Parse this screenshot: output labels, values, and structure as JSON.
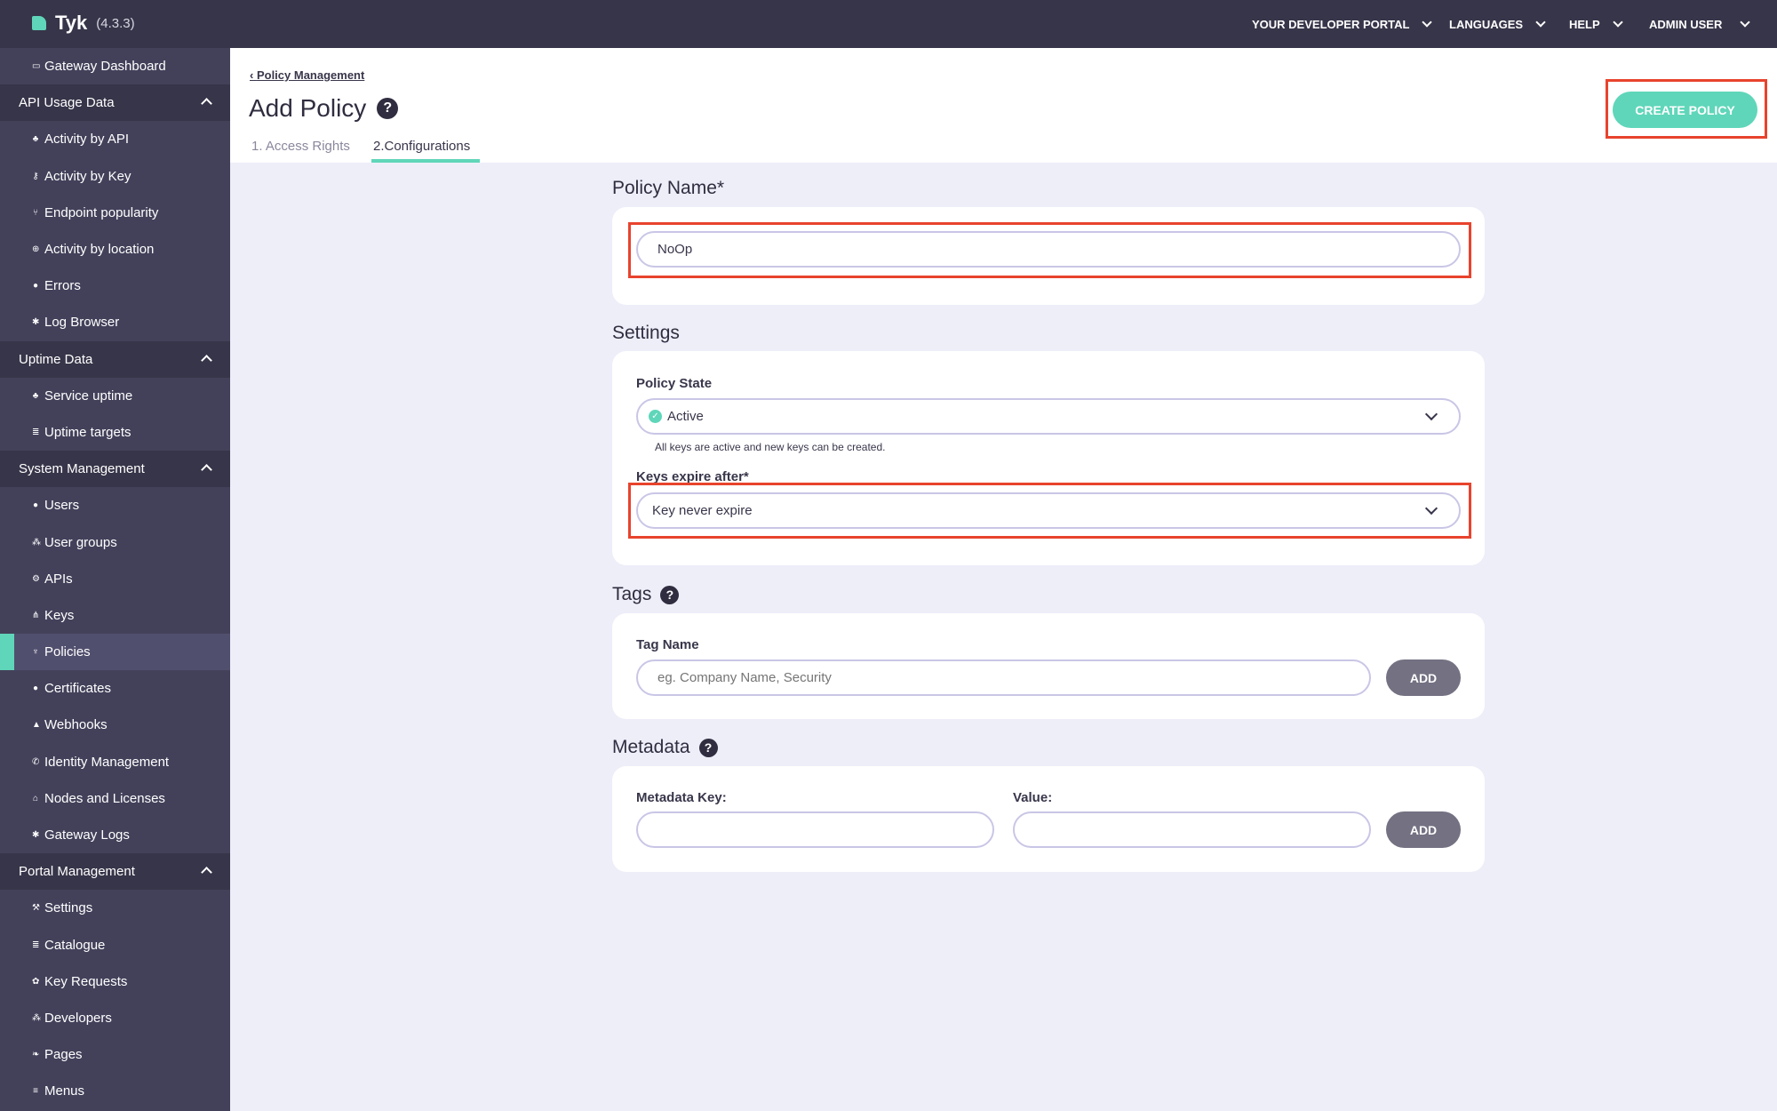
{
  "topbar": {
    "logo": "Tyk",
    "version": "(4.3.3)",
    "nav": [
      "YOUR DEVELOPER PORTAL",
      "LANGUAGES",
      "HELP",
      "ADMIN USER"
    ]
  },
  "sidebar": {
    "items": [
      {
        "label": "Gateway Dashboard",
        "type": "item",
        "icon": "monitor-icon",
        "glyph": "▭"
      },
      {
        "label": "API Usage Data",
        "type": "head"
      },
      {
        "label": "Activity by API",
        "type": "item",
        "icon": "cubes-icon",
        "glyph": "♣"
      },
      {
        "label": "Activity by Key",
        "type": "item",
        "icon": "key-icon",
        "glyph": "⚷"
      },
      {
        "label": "Endpoint popularity",
        "type": "item",
        "icon": "fork-icon",
        "glyph": "⑂"
      },
      {
        "label": "Activity by location",
        "type": "item",
        "icon": "globe-icon",
        "glyph": "⊕"
      },
      {
        "label": "Errors",
        "type": "item",
        "icon": "bomb-icon",
        "glyph": "●"
      },
      {
        "label": "Log Browser",
        "type": "item",
        "icon": "bug-icon",
        "glyph": "✱"
      },
      {
        "label": "Uptime Data",
        "type": "head"
      },
      {
        "label": "Service uptime",
        "type": "item",
        "icon": "cubes-icon",
        "glyph": "♣"
      },
      {
        "label": "Uptime targets",
        "type": "item",
        "icon": "list-icon",
        "glyph": "≣"
      },
      {
        "label": "System Management",
        "type": "head"
      },
      {
        "label": "Users",
        "type": "item",
        "icon": "user-icon",
        "glyph": "●"
      },
      {
        "label": "User groups",
        "type": "item",
        "icon": "users-icon",
        "glyph": "⁂"
      },
      {
        "label": "APIs",
        "type": "item",
        "icon": "cogs-icon",
        "glyph": "⚙"
      },
      {
        "label": "Keys",
        "type": "item",
        "icon": "sitemap-icon",
        "glyph": "⋔"
      },
      {
        "label": "Policies",
        "type": "item",
        "icon": "plug-icon",
        "glyph": "♆",
        "active": true
      },
      {
        "label": "Certificates",
        "type": "item",
        "icon": "certificate-icon",
        "glyph": "●"
      },
      {
        "label": "Webhooks",
        "type": "item",
        "icon": "bell-icon",
        "glyph": "▲"
      },
      {
        "label": "Identity Management",
        "type": "item",
        "icon": "phone-icon",
        "glyph": "✆"
      },
      {
        "label": "Nodes and Licenses",
        "type": "item",
        "icon": "bank-icon",
        "glyph": "⌂"
      },
      {
        "label": "Gateway Logs",
        "type": "item",
        "icon": "bug-icon",
        "glyph": "✱"
      },
      {
        "label": "Portal Management",
        "type": "head"
      },
      {
        "label": "Settings",
        "type": "item",
        "icon": "wrench-icon",
        "glyph": "⚒"
      },
      {
        "label": "Catalogue",
        "type": "item",
        "icon": "list-icon",
        "glyph": "≣"
      },
      {
        "label": "Key Requests",
        "type": "item",
        "icon": "paw-icon",
        "glyph": "✿"
      },
      {
        "label": "Developers",
        "type": "item",
        "icon": "users-icon",
        "glyph": "⁂"
      },
      {
        "label": "Pages",
        "type": "item",
        "icon": "leaf-icon",
        "glyph": "❧"
      },
      {
        "label": "Menus",
        "type": "item",
        "icon": "bars-icon",
        "glyph": "≡"
      }
    ]
  },
  "page": {
    "breadcrumb": "Policy Management",
    "title": "Add Policy",
    "tabs": [
      "1. Access Rights",
      "2.Configurations"
    ],
    "active_tab": 1,
    "create_button": "CREATE POLICY"
  },
  "form": {
    "policy_name": {
      "heading": "Policy Name*",
      "value": "NoOp"
    },
    "settings": {
      "heading": "Settings",
      "state_label": "Policy State",
      "state_value": "Active",
      "state_help": "All keys are active and new keys can be created.",
      "expire_label": "Keys expire after*",
      "expire_value": "Key never expire"
    },
    "tags": {
      "heading": "Tags",
      "label": "Tag Name",
      "placeholder": "eg. Company Name, Security",
      "add": "ADD"
    },
    "metadata": {
      "heading": "Metadata",
      "key_label": "Metadata Key:",
      "value_label": "Value:",
      "add": "ADD"
    }
  },
  "colors": {
    "accent": "#5fd6b9",
    "header": "#373549",
    "sidebar": "#43415a",
    "highlight": "#e8432d"
  }
}
